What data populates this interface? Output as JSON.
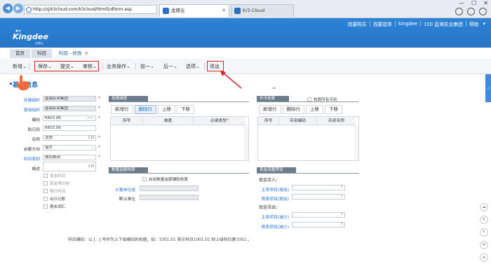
{
  "browser": {
    "url": "http://zj/k3cloud.com/k3cloud/html5/dform.asp",
    "tabs": [
      {
        "label": "金蝶云"
      },
      {
        "label": "K/3 Cloud"
      }
    ]
  },
  "header": {
    "brand": "Kingdee",
    "brand_sub": "金蝶云",
    "nav": [
      "找要购买",
      "找要提单",
      "kingdee",
      "100 蓝海实业集团",
      "帮助"
    ]
  },
  "app_tabs": [
    {
      "label": "首页"
    },
    {
      "label": "科目"
    },
    {
      "label": "科目 - 修改"
    }
  ],
  "toolbar": {
    "new": "新增",
    "save": "保存",
    "submit": "提交",
    "audit": "审核",
    "business": "业务操作",
    "prev": "前一",
    "next": "后一",
    "options": "选项",
    "exit": "退出"
  },
  "section_title": "基本信息",
  "form": {
    "create_org": {
      "label": "创建组织",
      "value": "蓝海实业集团"
    },
    "use_org": {
      "label": "使用组织",
      "value": "蓝海实业集团"
    },
    "code": {
      "label": "编码",
      "value": "6603.06"
    },
    "mnemonic": {
      "label": "助记码",
      "value": "6603.06"
    },
    "name": {
      "label": "名称",
      "value": "其他",
      "suffix": "CN"
    },
    "balance_dir": {
      "label": "余额方向",
      "value": "借方"
    },
    "category": {
      "label": "科目类别",
      "value": "期间费用"
    },
    "desc": {
      "label": "描述",
      "suffix": "CN"
    },
    "checks": [
      {
        "label": "现金科目",
        "enabled": false
      },
      {
        "label": "现金等价物",
        "enabled": false
      },
      {
        "label": "银行科目",
        "enabled": false
      },
      {
        "label": "出日记账",
        "enabled": true
      },
      {
        "label": "期末调汇",
        "enabled": true
      }
    ]
  },
  "aux_panel": {
    "title": "核算维度",
    "buttons": [
      "新增行",
      "删除行",
      "上移",
      "下移"
    ],
    "columns": [
      "序号",
      "维度",
      "必录类型"
    ]
  },
  "qty_panel": {
    "title": "数量金额核算",
    "enable_label": "启用数量金额辅助核算",
    "unit_group_label": "计量单位组",
    "default_unit_label": "默认单位"
  },
  "fx_panel": {
    "title": "外币核算",
    "all_currency_label": "核算所有币别",
    "buttons": [
      "新增行",
      "删除行",
      "上移",
      "下移"
    ],
    "columns": [
      "序号",
      "币别编码",
      "币别名称"
    ]
  },
  "cash_panel": {
    "title": "现金流量预设",
    "inflow_label": "现金流入：",
    "outflow_label": "现金流出：",
    "main_in": "主表项目(增加)",
    "attach_in": "附表项目(增加)",
    "main_out": "主表项目(减少)",
    "attach_out": "附表项目(减少)"
  },
  "note": "科目编码：以 [ . ] 号作为上下级编码的依据，如：1001.01 表示科目1001.01 的上级科目是1001 。"
}
